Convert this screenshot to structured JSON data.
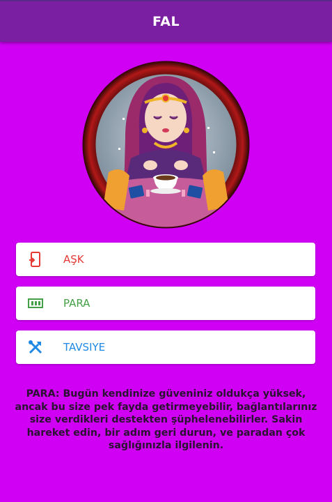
{
  "appbar": {
    "title": "FAL"
  },
  "avatar": {
    "name": "fortune-teller-avatar"
  },
  "menu": [
    {
      "label": "AŞK",
      "icon": "share-phone-icon",
      "color": "#e53935"
    },
    {
      "label": "PARA",
      "icon": "money-icon",
      "color": "#43a047"
    },
    {
      "label": "TAVSIYE",
      "icon": "tools-icon",
      "color": "#1e88e5"
    }
  ],
  "fortune": {
    "text": "PARA: Bugün kendinize güveniniz oldukça yüksek, ancak bu size pek fayda getirmeyebilir, bağlantılarınız size verdikleri destekten şüphelenebilirler. Sakin hareket edin, bir adım geri durun, ve paradan çok sağlığınızla ilgilenin."
  },
  "colors": {
    "background": "#d000f5",
    "appbar": "#7b1fa2"
  }
}
